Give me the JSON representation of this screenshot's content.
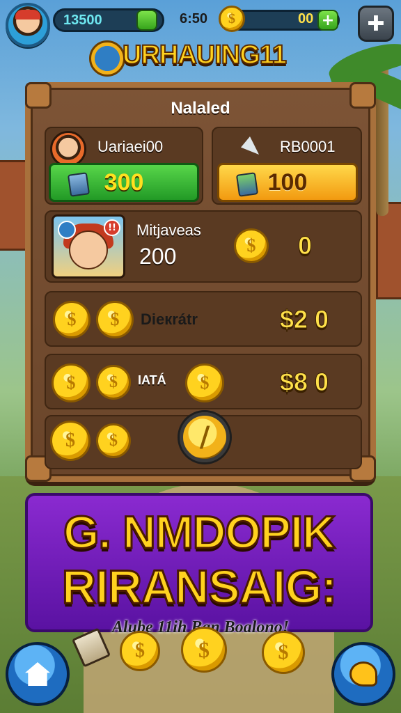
{
  "hud": {
    "gems_value": "13500",
    "coins_label": "6:50",
    "coins_value": "00",
    "plus_icon": "+",
    "settings_icon": "puzzle-icon"
  },
  "title": {
    "text": "URHAUING11"
  },
  "panel": {
    "title": "Nalaled",
    "offer_left": {
      "label": "Uariaei00",
      "price": "300"
    },
    "offer_right": {
      "label": "RB0001",
      "price": "100"
    },
    "row1": {
      "label": "Mitjaveas",
      "amount": "200",
      "value": "0",
      "badge": "!!"
    },
    "row2": {
      "label": "Dieкrátr",
      "value": "$2 0"
    },
    "row3": {
      "label": "IATÁ",
      "value": "$8 0"
    },
    "row4": {
      "button_symbol": "/"
    }
  },
  "promo": {
    "line1": "G. NMDOPIK",
    "line2": "RIRANSAIG:",
    "subtitle": "Alube 11ih Ban Boalono!"
  },
  "coin_glyph": "$",
  "colors": {
    "accent_gold": "#ffd21f",
    "wood": "#7d5436",
    "promo_purple": "#8a2ad0",
    "buy_green": "#229a26",
    "buy_yellow": "#f29a10"
  }
}
